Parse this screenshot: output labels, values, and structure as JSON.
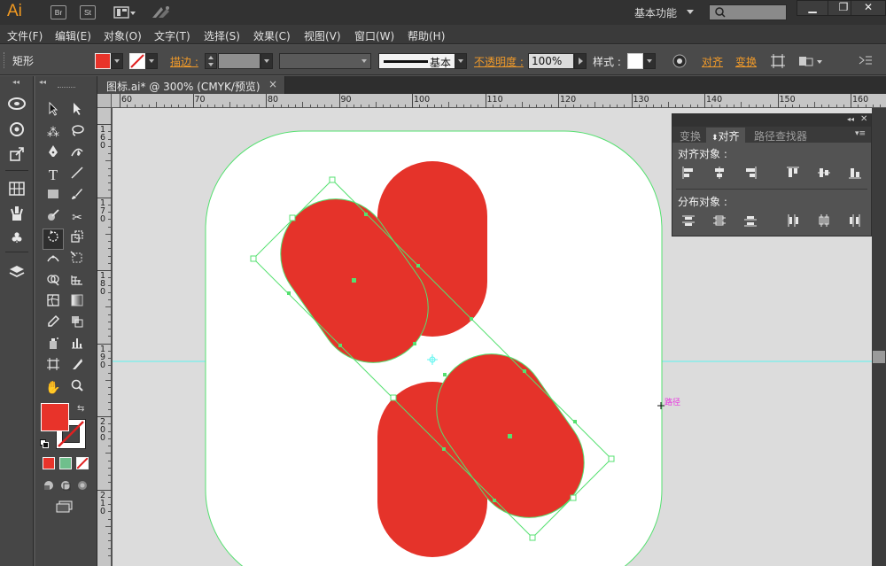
{
  "app": {
    "logo": "Ai",
    "br": "Br",
    "st": "St",
    "workspace": "基本功能"
  },
  "window_controls": {
    "minimize": "▁",
    "restore": "❐",
    "close": "✕"
  },
  "menu": [
    "文件(F)",
    "编辑(E)",
    "对象(O)",
    "文字(T)",
    "选择(S)",
    "效果(C)",
    "视图(V)",
    "窗口(W)",
    "帮助(H)"
  ],
  "control_bar": {
    "shape_label": "矩形",
    "fill_color": "#e8332a",
    "stroke_label": "描边 :",
    "brush_label": "基本",
    "opacity_label": "不透明度 :",
    "opacity_value": "100%",
    "style_label": "样式 :",
    "align_label": "对齐",
    "transform_label": "变换"
  },
  "document_tab": {
    "title": "图标.ai* @ 300% (CMYK/预览)",
    "close": "×"
  },
  "ruler": {
    "horizontal": [
      "60",
      "70",
      "80",
      "90",
      "100",
      "110",
      "120",
      "130",
      "140",
      "150",
      "160"
    ],
    "vertical": [
      "160",
      "170",
      "180",
      "190",
      "200",
      "210"
    ]
  },
  "align_panel": {
    "tabs": [
      "变换",
      "对齐",
      "路径查找器"
    ],
    "active_tab": "对齐",
    "align_objects_title": "对齐对象 :",
    "distribute_objects_title": "分布对象 :"
  },
  "canvas": {
    "hover_annotation": "路径",
    "shape_color": "#e5332a",
    "guide_color": "#5df5f0",
    "selection_color": "#55e070"
  }
}
